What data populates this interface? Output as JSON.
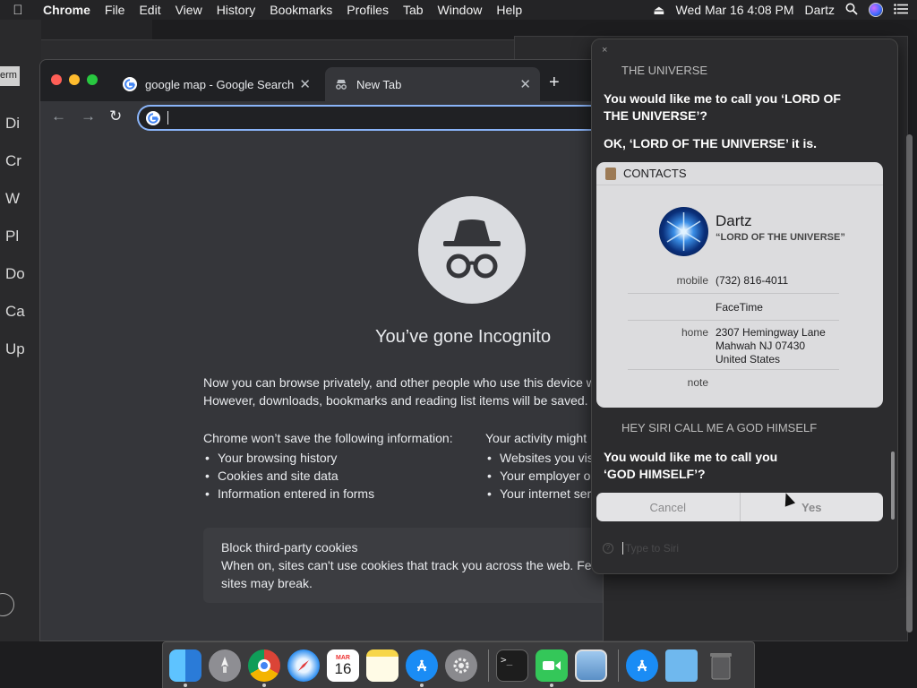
{
  "menubar": {
    "app_name": "Chrome",
    "menus": [
      "File",
      "Edit",
      "View",
      "History",
      "Bookmarks",
      "Profiles",
      "Tab",
      "Window",
      "Help"
    ],
    "clock": "Wed Mar 16  4:08 PM",
    "user": "Dartz"
  },
  "left_strip": [
    "Di",
    "Cr",
    "W",
    "Pl",
    "Do",
    "Ca",
    "Up"
  ],
  "bg_fragment": "erm",
  "chrome": {
    "tabs": [
      {
        "title": "google map - Google Search",
        "active": false
      },
      {
        "title": "New Tab",
        "active": true
      }
    ],
    "new_tab_symbol": "+",
    "omnibox_value": "",
    "incognito_heading": "You’ve gone Incognito",
    "intro_line1": "Now you can browse privately, and other people who use this device w",
    "intro_line2": "However, downloads, bookmarks and reading list items will be saved.",
    "wont_save_title": "Chrome won’t save the following information:",
    "wont_save_items": [
      "Your browsing history",
      "Cookies and site data",
      "Information entered in forms"
    ],
    "visible_title": "Your activity might",
    "visible_items": [
      "Websites you vis",
      "Your employer or",
      "Your internet ser"
    ],
    "cookies_title": "Block third-party cookies",
    "cookies_line1": "When on, sites can't use cookies that track you across the web. Fea",
    "cookies_line2": "sites may break."
  },
  "siri": {
    "close": "×",
    "echo1": "THE UNIVERSE",
    "resp1_line1": "You would like me to call you ‘LORD OF",
    "resp1_line2": "THE UNIVERSE’?",
    "resp2": "OK, ‘LORD OF THE UNIVERSE’ it is.",
    "card": {
      "header": "CONTACTS",
      "name": "Dartz",
      "nickname": "“LORD OF THE UNIVERSE”",
      "mobile_label": "mobile",
      "mobile_value": "(732) 816-4011",
      "facetime": "FaceTime",
      "home_label": "home",
      "address_line1": "2307 Hemingway Lane",
      "address_line2": "Mahwah NJ 07430",
      "address_line3": "United States",
      "note_label": "note"
    },
    "echo2": "HEY SIRI CALL ME A GOD HIMSELF",
    "resp3_line1": "You would like me to call you",
    "resp3_line2": "‘GOD HIMSELF’?",
    "cancel_label": "Cancel",
    "yes_label": "Yes",
    "input_placeholder": "Type to Siri"
  },
  "dock": {
    "items": [
      "finder-icon",
      "launchpad-icon",
      "chrome-icon",
      "safari-icon",
      "calendar-icon",
      "notes-icon",
      "app-store-icon",
      "system-preferences-icon",
      "terminal-icon",
      "facetime-icon",
      "preview-icon",
      "app-store-icon",
      "downloads-folder-icon",
      "trash-icon"
    ],
    "calendar_month": "MAR",
    "calendar_day": "16",
    "terminal_prompt": ">_"
  },
  "colors": {
    "chrome_bg": "#35363a",
    "omnibox_focus": "#8ab4f8",
    "siri_bg": "#2c2c2e",
    "card_bg": "#dcdcde"
  }
}
